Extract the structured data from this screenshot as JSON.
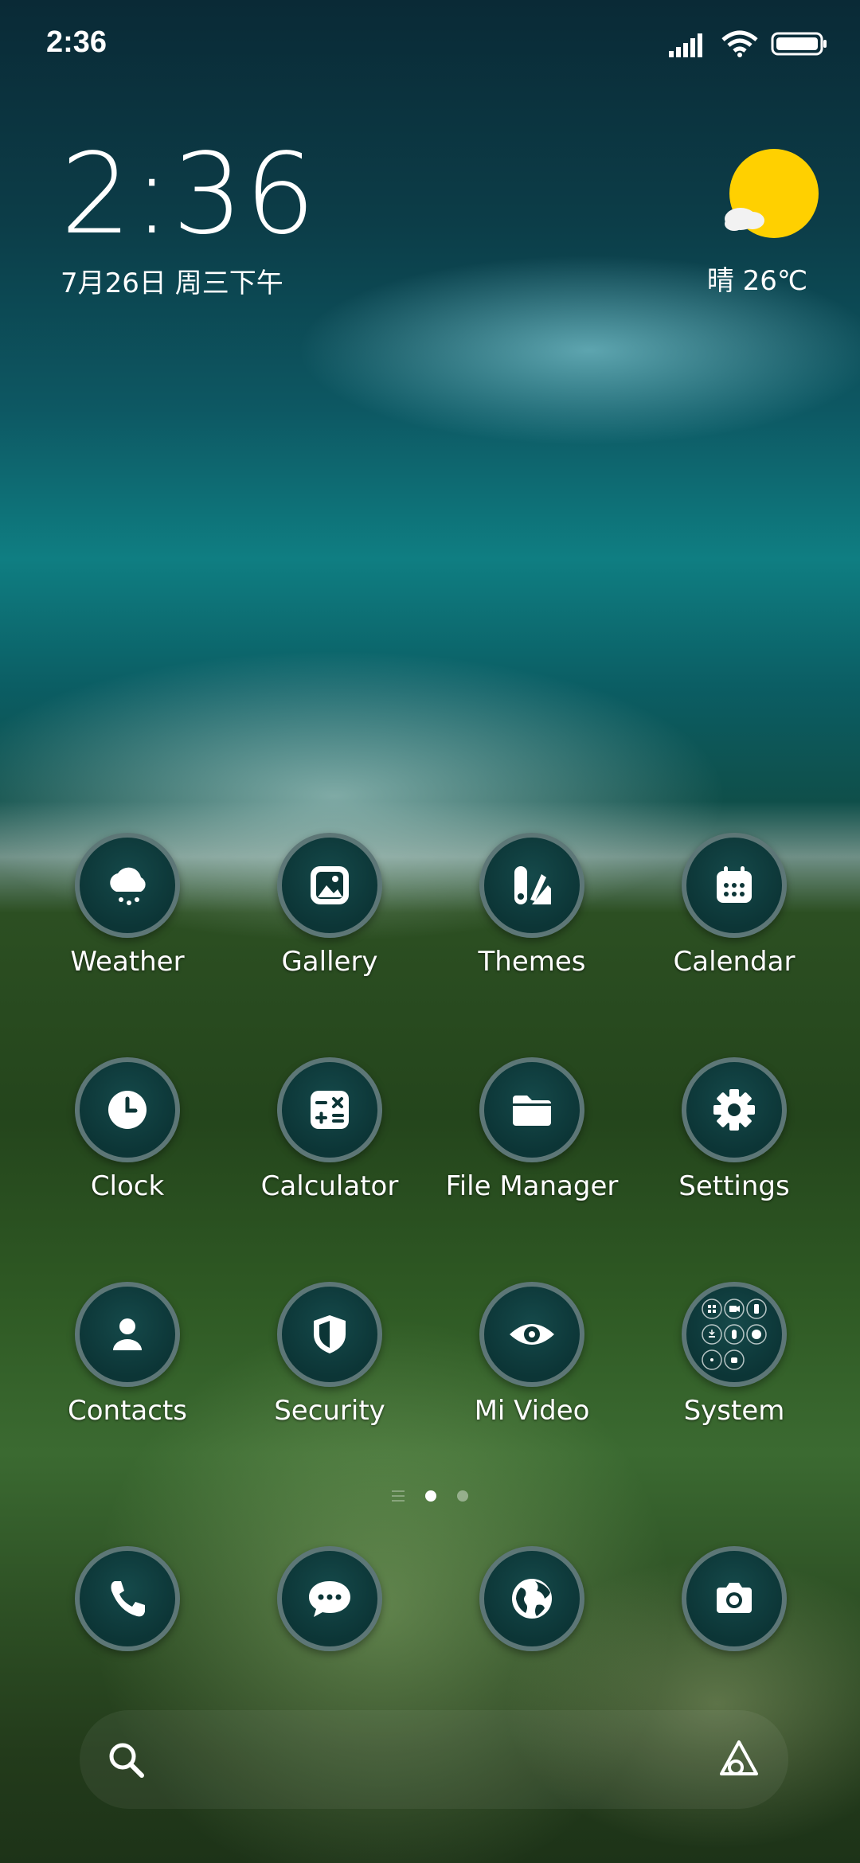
{
  "status_bar": {
    "time": "2:36"
  },
  "clock_widget": {
    "time": "2:36",
    "date": "7月26日 周三下午"
  },
  "weather_widget": {
    "text": "晴 26℃",
    "icon": "sunny-partly-cloudy-icon",
    "sun_color": "#FFD000"
  },
  "apps": [
    {
      "label": "Weather",
      "icon": "weather-cloud-icon"
    },
    {
      "label": "Gallery",
      "icon": "gallery-icon"
    },
    {
      "label": "Themes",
      "icon": "themes-icon"
    },
    {
      "label": "Calendar",
      "icon": "calendar-icon"
    },
    {
      "label": "Clock",
      "icon": "clock-icon"
    },
    {
      "label": "Calculator",
      "icon": "calculator-icon"
    },
    {
      "label": "File Manager",
      "icon": "folder-icon"
    },
    {
      "label": "Settings",
      "icon": "gear-icon"
    },
    {
      "label": "Contacts",
      "icon": "contact-icon"
    },
    {
      "label": "Security",
      "icon": "shield-icon"
    },
    {
      "label": "Mi Video",
      "icon": "eye-icon"
    },
    {
      "label": "System",
      "icon": "app-folder-icon"
    }
  ],
  "dock": [
    {
      "icon": "phone-icon"
    },
    {
      "icon": "message-icon"
    },
    {
      "icon": "browser-globe-icon"
    },
    {
      "icon": "camera-icon"
    }
  ],
  "page_indicator": {
    "current_page": 1,
    "total_pages": 2
  },
  "colors": {
    "icon_bg": "#0C3536",
    "icon_ring": "#7A8C8C",
    "accent_sun": "#FFD000"
  }
}
